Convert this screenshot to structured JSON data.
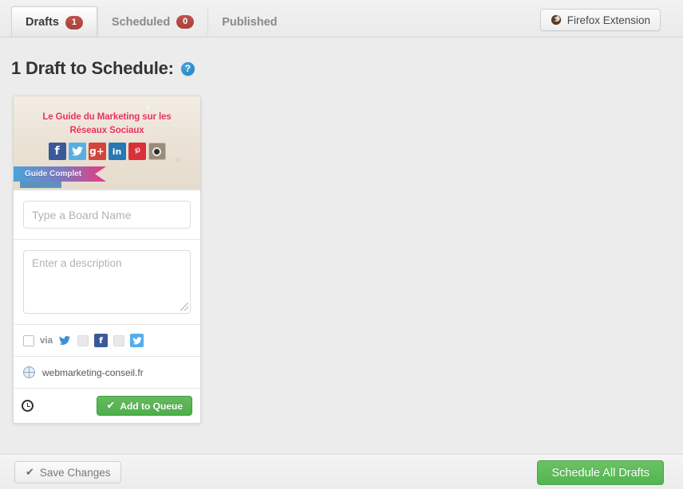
{
  "tabs": [
    {
      "label": "Drafts",
      "badge": "1",
      "active": true
    },
    {
      "label": "Scheduled",
      "badge": "0",
      "active": false
    },
    {
      "label": "Published",
      "badge": "",
      "active": false
    }
  ],
  "header": {
    "firefox_extension_label": "Firefox Extension",
    "firefox_icon": "firefox-icon"
  },
  "heading": {
    "title": "1 Draft to Schedule:",
    "help_glyph": "?"
  },
  "card": {
    "thumbnail": {
      "title_line1": "Le Guide du Marketing sur les",
      "title_line2": "Réseaux Sociaux",
      "ribbon_label": "Guide Complet",
      "socials": [
        {
          "name": "facebook-icon",
          "glyph": "f"
        },
        {
          "name": "twitter-icon",
          "glyph": "ᵛ"
        },
        {
          "name": "googleplus-icon",
          "glyph": "g+"
        },
        {
          "name": "linkedin-icon",
          "glyph": "in"
        },
        {
          "name": "pinterest-icon",
          "glyph": "ⓟ"
        },
        {
          "name": "instagram-icon",
          "glyph": ""
        }
      ]
    },
    "board_name": {
      "value": "",
      "placeholder": "Type a Board Name"
    },
    "description": {
      "value": "",
      "placeholder": "Enter a description"
    },
    "via_row": {
      "via_label": "via",
      "buffer_glyph": "❯",
      "facebook_glyph": "f",
      "twitter_glyph": "ᵛ"
    },
    "url": "webmarketing-conseil.fr",
    "add_to_queue_label": "Add to Queue",
    "check_glyph": "✔"
  },
  "footer": {
    "save_label": "Save Changes",
    "save_check_glyph": "✔",
    "schedule_label": "Schedule All Drafts"
  },
  "colors": {
    "green": "#52b551",
    "badge_red": "#ab3f39",
    "accent_pink": "#e8305a",
    "help_blue": "#2b8fcc"
  }
}
